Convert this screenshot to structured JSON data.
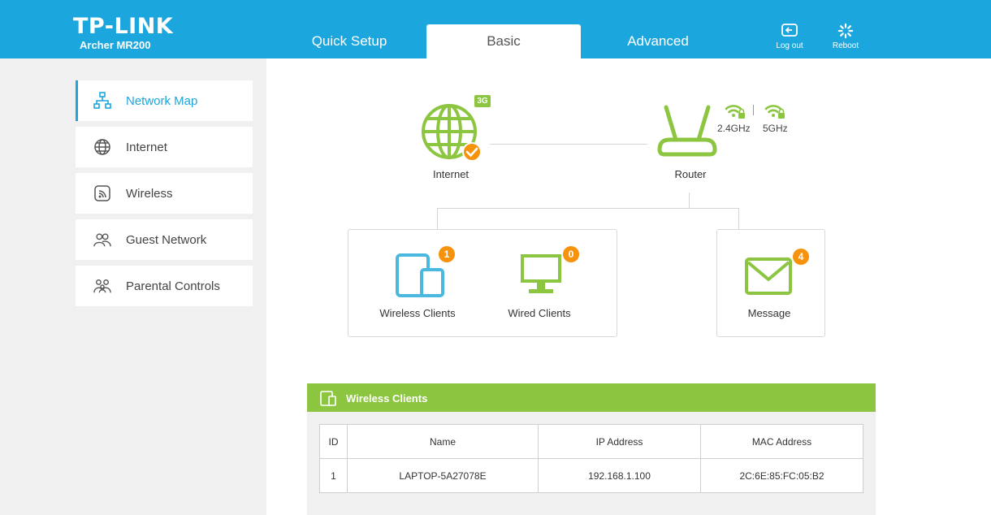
{
  "header": {
    "brand": "TP-LINK",
    "model": "Archer MR200",
    "tabs": [
      {
        "label": "Quick Setup"
      },
      {
        "label": "Basic"
      },
      {
        "label": "Advanced"
      }
    ],
    "active_tab": "Basic",
    "logout_label": "Log out",
    "reboot_label": "Reboot"
  },
  "sidebar": {
    "items": [
      {
        "label": "Network Map",
        "icon": "network-map-icon"
      },
      {
        "label": "Internet",
        "icon": "globe-icon"
      },
      {
        "label": "Wireless",
        "icon": "wireless-icon"
      },
      {
        "label": "Guest Network",
        "icon": "guest-icon"
      },
      {
        "label": "Parental Controls",
        "icon": "parental-icon"
      }
    ],
    "active_item": "Network Map"
  },
  "map": {
    "internet_label": "Internet",
    "internet_tag": "3G",
    "router_label": "Router",
    "band_24": "2.4GHz",
    "band_5": "5GHz",
    "wireless_clients_label": "Wireless Clients",
    "wireless_clients_count": "1",
    "wired_clients_label": "Wired Clients",
    "wired_clients_count": "0",
    "message_label": "Message",
    "message_count": "4"
  },
  "clients_panel": {
    "title": "Wireless Clients",
    "columns": [
      "ID",
      "Name",
      "IP Address",
      "MAC Address"
    ],
    "rows": [
      {
        "id": "1",
        "name": "LAPTOP-5A27078E",
        "ip": "192.168.1.100",
        "mac": "2C:6E:85:FC:05:B2"
      }
    ]
  },
  "colors": {
    "brand_blue": "#1ba6dd",
    "accent_green": "#8cc53f",
    "badge_orange": "#f7920d"
  }
}
